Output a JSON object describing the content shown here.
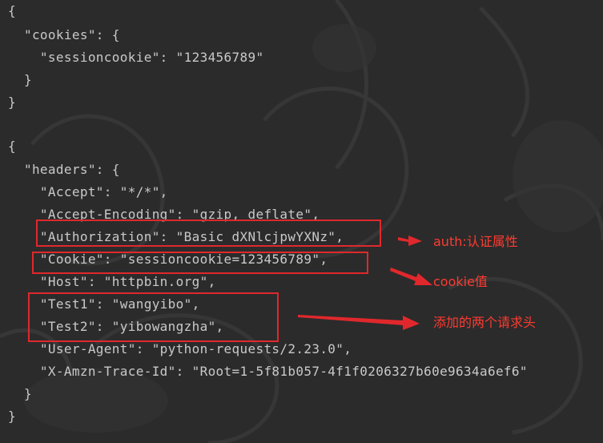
{
  "code_lines": [
    "{",
    "  \"cookies\": {",
    "    \"sessioncookie\": \"123456789\"",
    "  }",
    "}",
    "",
    "{",
    "  \"headers\": {",
    "    \"Accept\": \"*/*\",",
    "    \"Accept-Encoding\": \"gzip, deflate\",",
    "    \"Authorization\": \"Basic dXNlcjpwYXNz\",",
    "    \"Cookie\": \"sessioncookie=123456789\",",
    "    \"Host\": \"httpbin.org\",",
    "    \"Test1\": \"wangyibo\",",
    "    \"Test2\": \"yibowangzha\",",
    "    \"User-Agent\": \"python-requests/2.23.0\",",
    "    \"X-Amzn-Trace-Id\": \"Root=1-5f81b057-4f1f0206327b60e9634a6ef6\"",
    "  }",
    "}"
  ],
  "annotations": {
    "auth": "auth:认证属性",
    "cookie": "cookie值",
    "custom_headers": "添加的两个请求头"
  },
  "colors": {
    "background": "#2b2b2b",
    "code_text": "#c9c9c9",
    "highlight": "#e0282c",
    "annotation_text": "#ff3b30"
  }
}
